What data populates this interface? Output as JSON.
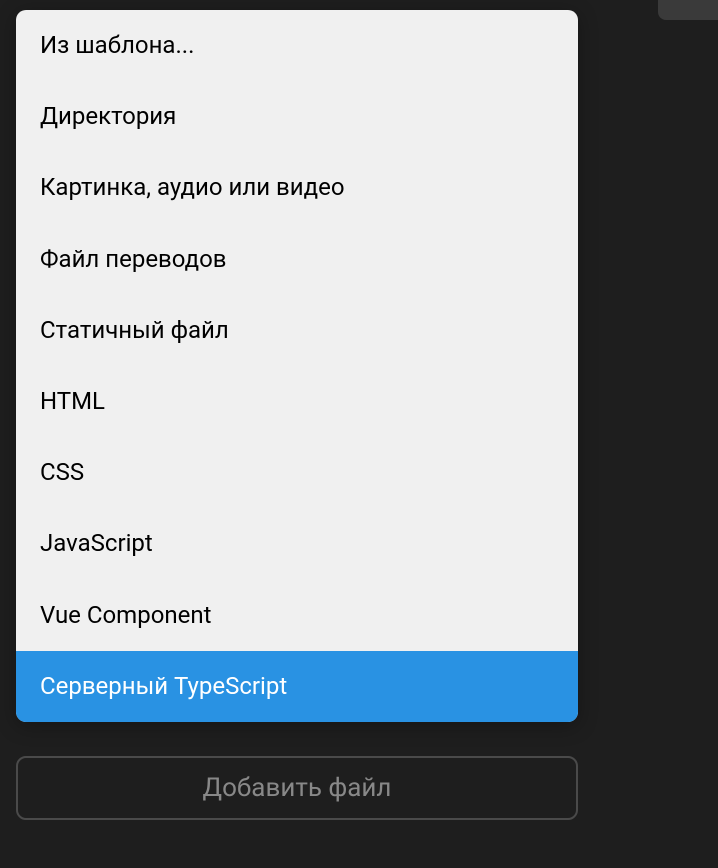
{
  "menu": {
    "items": [
      {
        "label": "Из шаблона...",
        "selected": false
      },
      {
        "label": "Директория",
        "selected": false
      },
      {
        "label": "Картинка, аудио или видео",
        "selected": false
      },
      {
        "label": "Файл переводов",
        "selected": false
      },
      {
        "label": "Статичный файл",
        "selected": false
      },
      {
        "label": "HTML",
        "selected": false
      },
      {
        "label": "CSS",
        "selected": false
      },
      {
        "label": "JavaScript",
        "selected": false
      },
      {
        "label": "Vue Component",
        "selected": false
      },
      {
        "label": "Серверный TypeScript",
        "selected": true
      }
    ]
  },
  "button": {
    "add_file_label": "Добавить файл"
  }
}
